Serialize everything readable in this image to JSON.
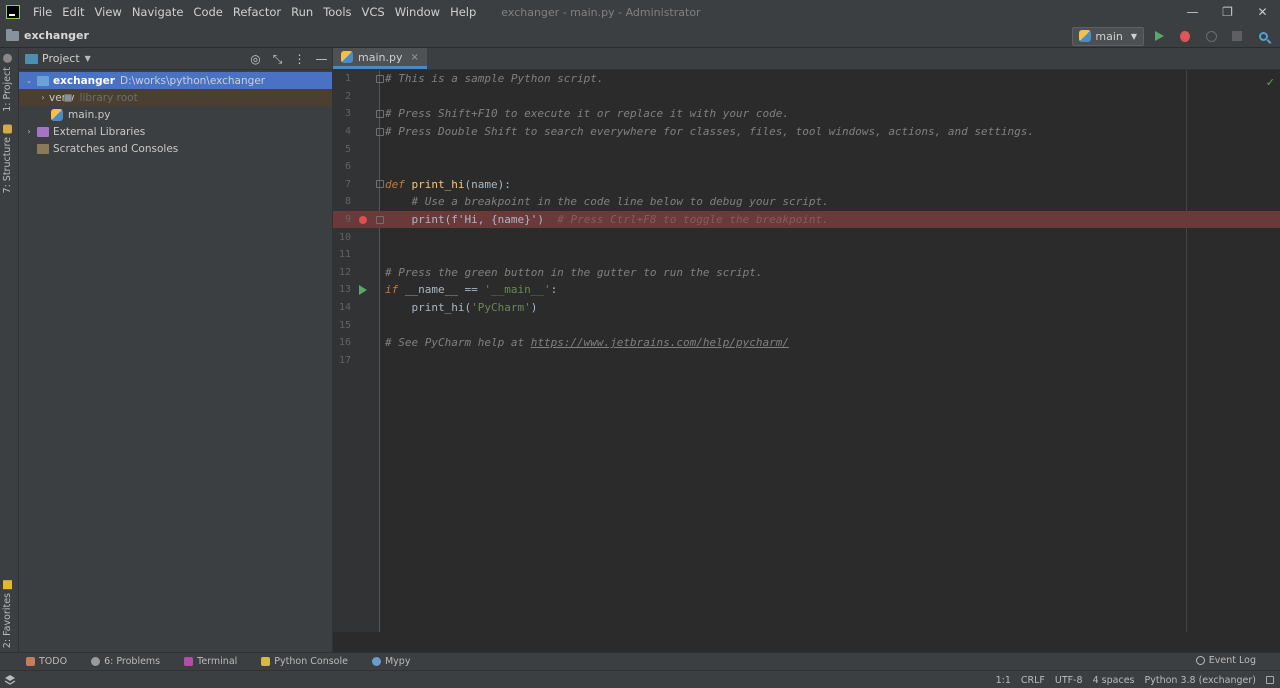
{
  "window": {
    "title": "exchanger - main.py - Administrator",
    "controls": [
      "—",
      "❐",
      "✕"
    ]
  },
  "menu": [
    {
      "label": "File"
    },
    {
      "label": "Edit"
    },
    {
      "label": "View"
    },
    {
      "label": "Navigate"
    },
    {
      "label": "Code"
    },
    {
      "label": "Refactor"
    },
    {
      "label": "Run"
    },
    {
      "label": "Tools"
    },
    {
      "label": "VCS"
    },
    {
      "label": "Window"
    },
    {
      "label": "Help"
    }
  ],
  "navbar": {
    "breadcrumb": "exchanger",
    "run_config": "main",
    "icons": [
      "run-icon",
      "debug-icon",
      "coverage-icon",
      "stop-icon",
      "search-icon"
    ]
  },
  "left_stripe": {
    "project_tab": "1: Project",
    "structure_tab": "7: Structure",
    "favorites_tab": "2: Favorites"
  },
  "project_panel": {
    "title": "Project",
    "tree": [
      {
        "label": "exchanger",
        "path": "D:\\works\\python\\exchanger"
      },
      {
        "label": "venv",
        "hint": "library root"
      },
      {
        "label": "main.py"
      },
      {
        "label": "External Libraries"
      },
      {
        "label": "Scratches and Consoles"
      }
    ]
  },
  "editor": {
    "tab": "main.py",
    "close": "×",
    "check": "✓",
    "lines": [
      {
        "n": "1"
      },
      {
        "n": "2"
      },
      {
        "n": "3"
      },
      {
        "n": "4"
      },
      {
        "n": "5"
      },
      {
        "n": "6"
      },
      {
        "n": "7"
      },
      {
        "n": "8"
      },
      {
        "n": "9"
      },
      {
        "n": "10"
      },
      {
        "n": "11"
      },
      {
        "n": "12"
      },
      {
        "n": "13"
      },
      {
        "n": "14"
      },
      {
        "n": "15"
      },
      {
        "n": "16"
      },
      {
        "n": "17"
      }
    ],
    "code": {
      "l1": "# This is a sample Python script.",
      "l3": "# Press Shift+F10 to execute it or replace it with your code.",
      "l4": "# Press Double Shift to search everywhere for classes, files, tool windows, actions, and settings.",
      "l7_kw": "def",
      "l7_fn": "print_hi",
      "l7_rest": "(name):",
      "l8": "    # Use a breakpoint in the code line below to debug your script.",
      "l9_code": "    print(f'Hi, {name}')",
      "l9_comment": "  # Press Ctrl+F8 to toggle the breakpoint.",
      "l12": "# Press the green button in the gutter to run the script.",
      "l13_kw": "if",
      "l13_dunder": "__name__",
      "l13_op": " == ",
      "l13_str": "'__main__'",
      "l13_end": ":",
      "l14_pre": "    print_hi(",
      "l14_str": "'PyCharm'",
      "l14_end": ")",
      "l16_pre": "# See PyCharm help at ",
      "l16_url": "https://www.jetbrains.com/help/pycharm/"
    }
  },
  "bottom_tabs": [
    {
      "label": "TODO"
    },
    {
      "label": "6: Problems"
    },
    {
      "label": "Terminal"
    },
    {
      "label": "Python Console"
    },
    {
      "label": "Mypy"
    }
  ],
  "event_log": "Event Log",
  "status": {
    "position": "1:1",
    "line_sep": "CRLF",
    "encoding": "UTF-8",
    "indent": "4 spaces",
    "interpreter": "Python 3.8 (exchanger)"
  },
  "colors": {
    "accent": "#4a88c7",
    "selection": "#4a72c4",
    "breakpoint_line": "#6a3a3a",
    "run_green": "#59a869",
    "debug_red": "#e05555"
  }
}
